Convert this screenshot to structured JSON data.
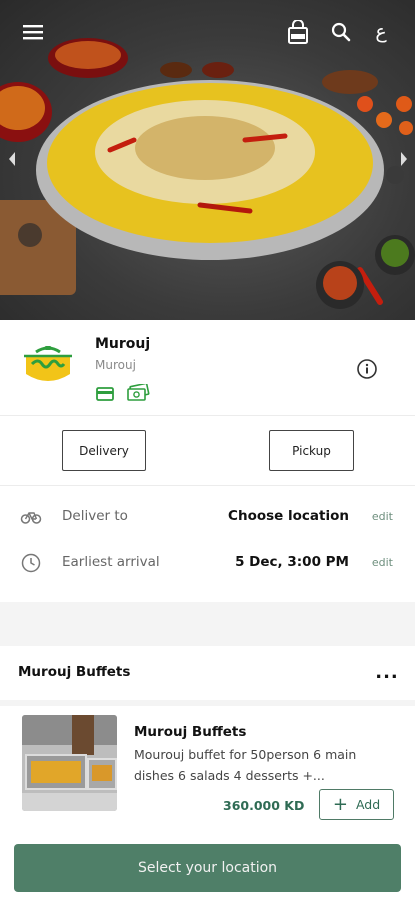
{
  "header": {
    "menu_icon": "hamburger-menu-icon",
    "cart_icon": "shopping-bag-icon",
    "search_icon": "search-icon",
    "language_label": "ع"
  },
  "hero": {
    "image_icon": "food-biryani-photo",
    "prev_icon": "chevron-left-icon",
    "next_icon": "chevron-right-icon"
  },
  "vendor": {
    "name": "Murouj",
    "subtitle": "Murouj",
    "logo_icon": "murouj-logo",
    "payment_icons": [
      "credit-card-icon",
      "cash-icon"
    ],
    "info_icon": "info-icon",
    "brand_color": "#2e9e3e"
  },
  "modes": {
    "delivery_label": "Delivery",
    "pickup_label": "Pickup"
  },
  "details": {
    "deliver_to": {
      "label": "Deliver to",
      "value": "Choose location",
      "edit": "edit",
      "icon": "bicycle-icon"
    },
    "earliest": {
      "label": "Earliest arrival",
      "value": "5 Dec, 3:00 PM",
      "edit": "edit",
      "icon": "clock-icon"
    }
  },
  "category": {
    "title": "Murouj Buffets",
    "more_label": "..."
  },
  "product": {
    "title": "Murouj Buffets",
    "description": "Mourouj buffet for 50person 6 main dishes 6 salads 4 desserts +...",
    "price": "360.000 KD",
    "add_label": "Add",
    "add_symbol": "+"
  },
  "cta": {
    "label": "Select your location",
    "color": "#4f7f68"
  }
}
